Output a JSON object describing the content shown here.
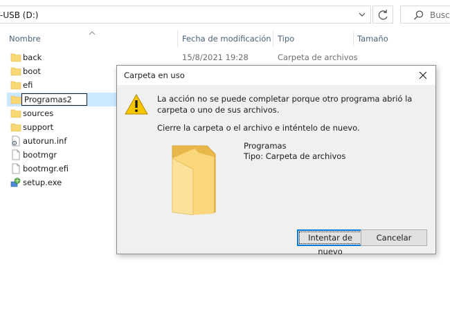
{
  "address_bar": {
    "path": "-USB (D:)",
    "search_placeholder": "Busca"
  },
  "columns": [
    {
      "label": "Nombre"
    },
    {
      "label": "Fecha de modificación"
    },
    {
      "label": "Tipo"
    },
    {
      "label": "Tamaño"
    }
  ],
  "files": [
    {
      "name": "back",
      "date": "15/8/2021 19:28",
      "type": "Carpeta de archivos",
      "icon": "folder-icon"
    },
    {
      "name": "boot",
      "date": "",
      "type": "",
      "icon": "folder-icon"
    },
    {
      "name": "efi",
      "date": "",
      "type": "",
      "icon": "folder-icon"
    },
    {
      "name": "Programas2",
      "date": "",
      "type": "",
      "icon": "folder-icon",
      "renaming": true
    },
    {
      "name": "sources",
      "date": "",
      "type": "",
      "icon": "folder-icon"
    },
    {
      "name": "support",
      "date": "",
      "type": "",
      "icon": "folder-icon"
    },
    {
      "name": "autorun.inf",
      "date": "",
      "type": "",
      "icon": "settings-file-icon"
    },
    {
      "name": "bootmgr",
      "date": "",
      "type": "",
      "icon": "file-icon"
    },
    {
      "name": "bootmgr.efi",
      "date": "",
      "type": "",
      "icon": "file-icon"
    },
    {
      "name": "setup.exe",
      "date": "",
      "type": "",
      "icon": "setup-exe-icon"
    }
  ],
  "dialog": {
    "title": "Carpeta en uso",
    "message": "La acción no se puede completar porque otro programa abrió la carpeta o uno de sus archivos.",
    "instruction": "Cierre la carpeta o el archivo e inténtelo de nuevo.",
    "item_name": "Programas",
    "item_type": "Tipo: Carpeta de archivos",
    "retry_label": "Intentar de nuevo",
    "cancel_label": "Cancelar"
  },
  "colors": {
    "selection": "#cce8ff",
    "accent": "#0078d7",
    "folder": "#f8d775",
    "dialog_bg": "#f0f0f0"
  }
}
